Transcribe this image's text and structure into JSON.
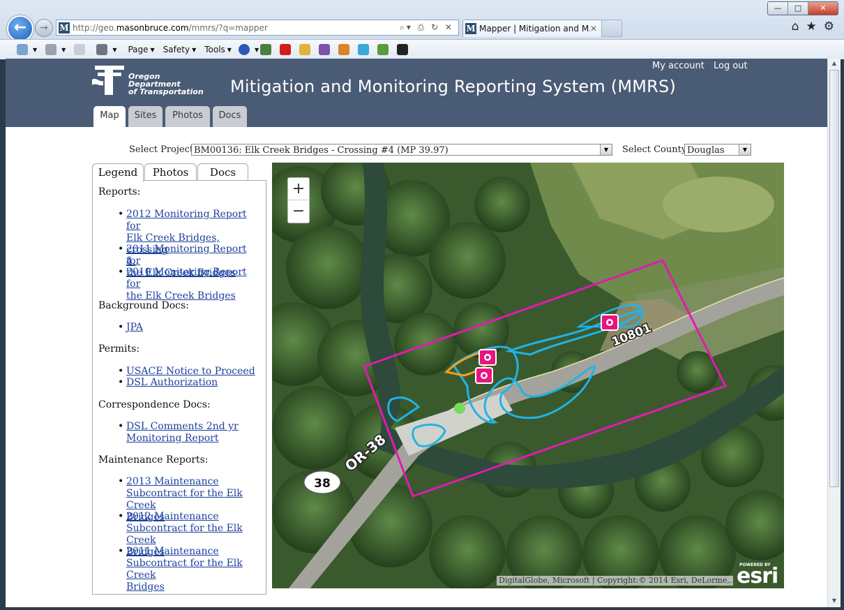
{
  "browser": {
    "url_prefix": "http://geo.",
    "url_domain": "masonbruce.com",
    "url_suffix": "/mmrs/?q=mapper",
    "tab_title": "Mapper | Mitigation and M...",
    "favicon_letter": "M",
    "menus": {
      "page": "Page",
      "safety": "Safety",
      "tools": "Tools"
    }
  },
  "header": {
    "logo_lines": [
      "Oregon",
      "Department",
      "of Transportation"
    ],
    "title": "Mitigation and Monitoring Reporting System (MMRS)",
    "my_account": "My account",
    "log_out": "Log out",
    "tabs": [
      "Map",
      "Sites",
      "Photos",
      "Docs"
    ],
    "active_tab": "Map"
  },
  "filters": {
    "project_label": "Select Project:",
    "project_value": "BM00136: Elk Creek Bridges - Crossing #4 (MP 39.97)",
    "county_label": "Select County:",
    "county_value": "Douglas"
  },
  "panel": {
    "tabs": [
      "Legend",
      "Photos",
      "Docs"
    ],
    "sections": [
      {
        "title": "Reports:",
        "items": [
          [
            "2012 Monitoring Report for",
            "Elk Creek Bridges, crossing",
            "4."
          ],
          [
            "2011 Monitoring Report for",
            "the Elk Creek Bridges"
          ],
          [
            "2010 Monitoring Report for",
            "the Elk Creek Bridges"
          ]
        ]
      },
      {
        "title": "Background Docs:",
        "items": [
          [
            "JPA"
          ]
        ]
      },
      {
        "title": "Permits:",
        "items": [
          [
            "USACE Notice to Proceed"
          ],
          [
            "DSL Authorization"
          ]
        ]
      },
      {
        "title": "Correspondence Docs:",
        "items": [
          [
            "DSL Comments 2nd yr",
            "Monitoring Report"
          ]
        ]
      },
      {
        "title": "Maintenance Reports:",
        "items": [
          [
            "2013 Maintenance",
            "Subcontract for the Elk Creek",
            "Bridges"
          ],
          [
            "2012 Maintenance",
            "Subcontract for the Elk Creek",
            "Bridges"
          ],
          [
            "2011 Maintenance",
            "Subcontract for the Elk Creek",
            "Bridges"
          ]
        ]
      }
    ]
  },
  "map": {
    "zoom_in": "+",
    "zoom_out": "−",
    "road_label_1": "10801",
    "road_label_2": "OR-38",
    "shield": "38",
    "attribution": "DigitalGlobe, Microsoft | Copyright:© 2014 Esri, DeLorme,...",
    "powered_by": "POWERED BY",
    "esri": "esri",
    "colors": {
      "boundary": "#e01bb0",
      "feature": "#1fb4ea",
      "orange": "#f0a020",
      "marker": "#e8157f"
    }
  }
}
